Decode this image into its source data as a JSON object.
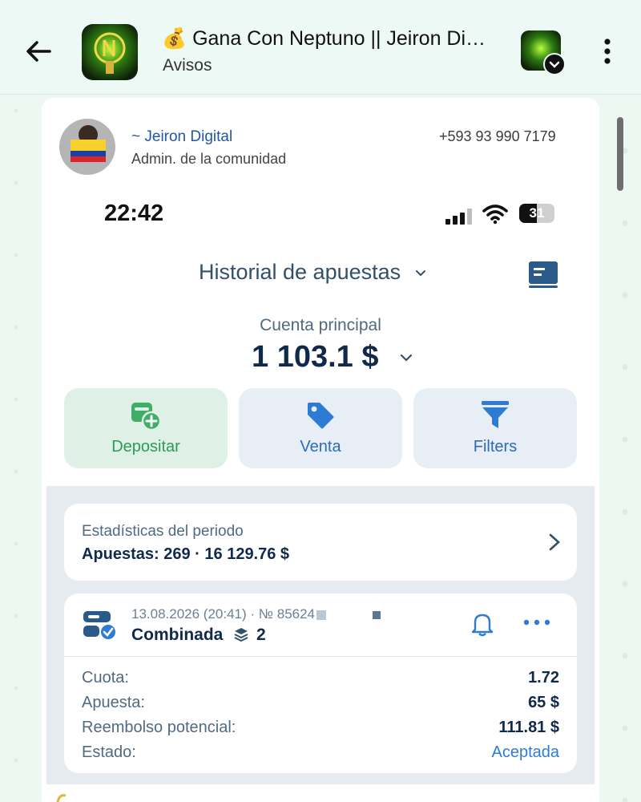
{
  "header": {
    "title": "💰 Gana Con Neptuno || Jeiron Di…",
    "subtitle": "Avisos"
  },
  "sender": {
    "name": "~ Jeiron Digital",
    "role": "Admin. de la comunidad",
    "phone": "+593 93 990 7179"
  },
  "status_bar": {
    "time": "22:42",
    "battery": "31"
  },
  "app": {
    "title": "Historial de apuestas",
    "account_label": "Cuenta principal",
    "account_amount": "1 103.1 $",
    "actions": [
      {
        "label": "Depositar",
        "icon": "wallet-plus-icon"
      },
      {
        "label": "Venta",
        "icon": "tag-icon"
      },
      {
        "label": "Filters",
        "icon": "funnel-icon"
      }
    ],
    "stats": {
      "title": "Estadísticas del periodo",
      "summary": "Apuestas: 269 · 16 129.76 $"
    },
    "bet": {
      "meta": "13.08.2026 (20:41) · № 85624",
      "type": "Combinada",
      "count": "2",
      "rows": [
        {
          "label": "Cuota:",
          "value": "1.72"
        },
        {
          "label": "Apuesta:",
          "value": "65 $"
        },
        {
          "label": "Reembolso potencial:",
          "value": "111.81 $"
        },
        {
          "label": "Estado:",
          "value": "Aceptada"
        }
      ]
    }
  },
  "colors": {
    "accent_blue": "#2e6ab4",
    "deposit_green": "#2d9a58",
    "navy_text": "#102a4c",
    "accepted_blue": "#2e7bd4"
  }
}
